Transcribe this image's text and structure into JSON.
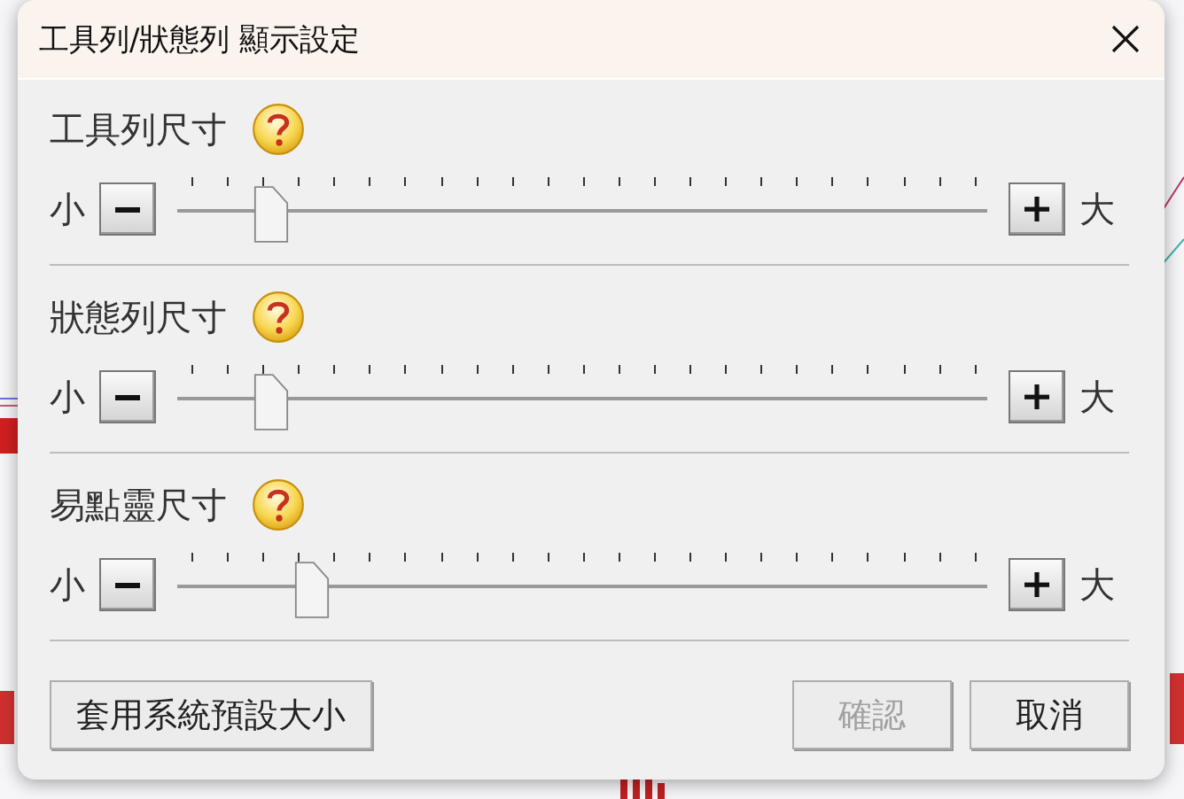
{
  "window": {
    "title": "工具列/狀態列 顯示設定"
  },
  "sections": [
    {
      "label": "工具列尺寸",
      "min_label": "小",
      "max_label": "大",
      "level": 0.09
    },
    {
      "label": "狀態列尺寸",
      "min_label": "小",
      "max_label": "大",
      "level": 0.09
    },
    {
      "label": "易點靈尺寸",
      "min_label": "小",
      "max_label": "大",
      "level": 0.14
    }
  ],
  "buttons": [
    {
      "label": "套用系統預設大小",
      "disabled": false
    },
    {
      "label": "確認",
      "disabled": true
    },
    {
      "label": "取消",
      "disabled": false
    }
  ]
}
